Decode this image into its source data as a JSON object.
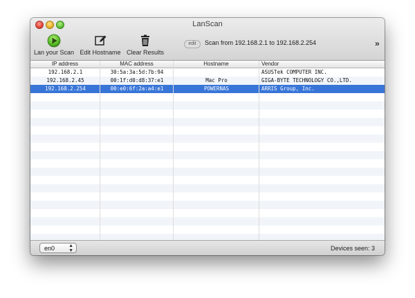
{
  "window": {
    "title": "LanScan"
  },
  "toolbar": {
    "scan_label": "Lan your Scan",
    "edit_hostname_label": "Edit Hostname",
    "clear_results_label": "Clear Results",
    "edit_chip": "edit",
    "scan_range": "Scan from 192.168.2.1 to 192.168.2.254",
    "overflow": "»"
  },
  "table": {
    "columns": [
      "IP address",
      "MAC address",
      "Hostname",
      "Vendor"
    ],
    "rows": [
      {
        "ip": "192.168.2.1",
        "mac": "30:5a:3a:5d:7b:94",
        "hostname": "",
        "vendor": "ASUSTek COMPUTER INC."
      },
      {
        "ip": "192.168.2.45",
        "mac": "00:1f:d0:d8:37:e1",
        "hostname": "Mac Pro",
        "vendor": "GIGA-BYTE TECHNOLOGY CO.,LTD."
      },
      {
        "ip": "192.168.2.254",
        "mac": "00:e0:6f:2a:a4:e1",
        "hostname": "POWERNAS",
        "vendor": "ARRIS Group, Inc."
      }
    ],
    "selected_row": 2
  },
  "statusbar": {
    "interface": "en0",
    "devices_seen": "Devices seen: 3"
  },
  "colors": {
    "selection": "#3875d7",
    "play_icon": "#5cbf2a",
    "stripe": "#f1f5fa"
  },
  "icons": {
    "scan": "play-icon",
    "edit": "pencil-edit-icon",
    "clear": "trash-icon"
  }
}
